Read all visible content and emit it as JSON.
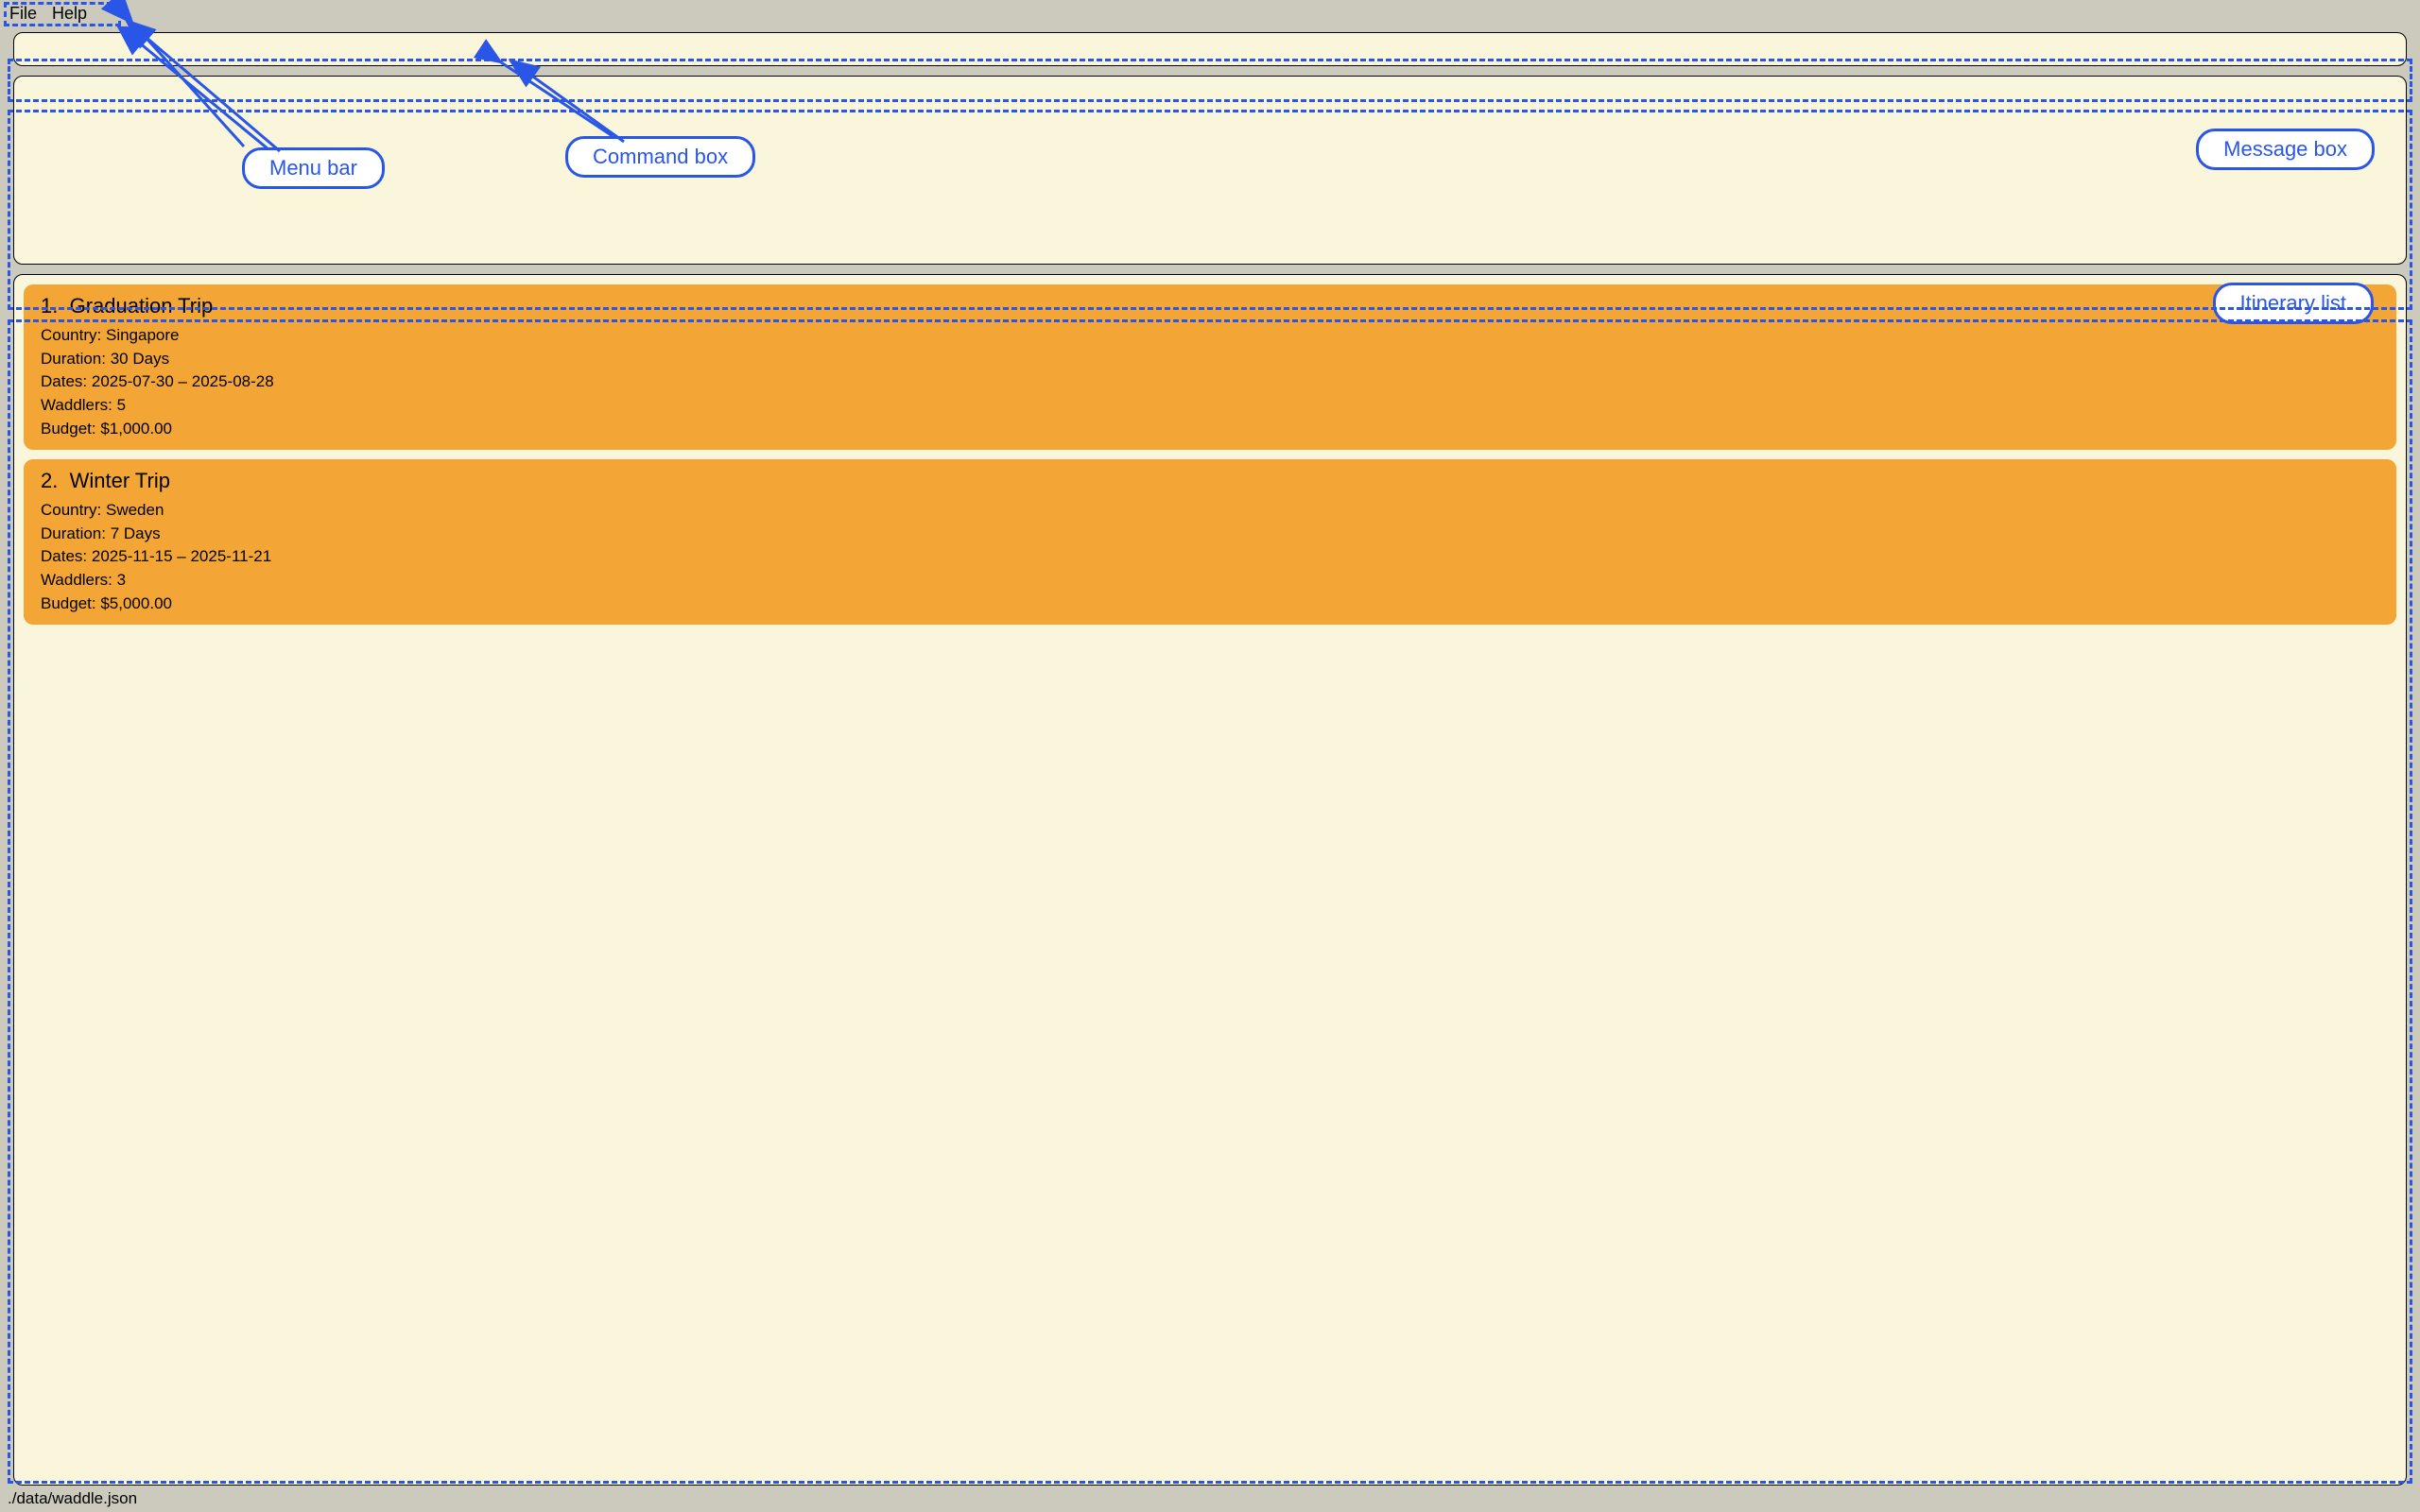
{
  "menubar": {
    "file": "File",
    "help": "Help"
  },
  "callouts": {
    "menu_bar": "Menu bar",
    "command_box": "Command box",
    "message_box": "Message box",
    "itinerary_list": "Itinerary list"
  },
  "command_box": {
    "value": ""
  },
  "labels": {
    "country": "Country:",
    "duration": "Duration:",
    "dates": "Dates:",
    "waddlers": "Waddlers:",
    "budget": "Budget:",
    "days_suffix": "Days"
  },
  "itineraries": [
    {
      "index": "1.",
      "name": "Graduation Trip",
      "country": "Singapore",
      "duration": "30 Days",
      "dates": "2025-07-30 – 2025-08-28",
      "waddlers": "5",
      "budget": "$1,000.00"
    },
    {
      "index": "2.",
      "name": "Winter Trip",
      "country": "Sweden",
      "duration": "7 Days",
      "dates": "2025-11-15 – 2025-11-21",
      "waddlers": "3",
      "budget": "$5,000.00"
    }
  ],
  "status_bar": {
    "path": "./data/waddle.json"
  },
  "colors": {
    "dashed_blue": "#2a56e8",
    "card_orange": "#f3a636",
    "panel_bg": "#f9f6dc",
    "chrome_bg": "#cbcabc"
  }
}
